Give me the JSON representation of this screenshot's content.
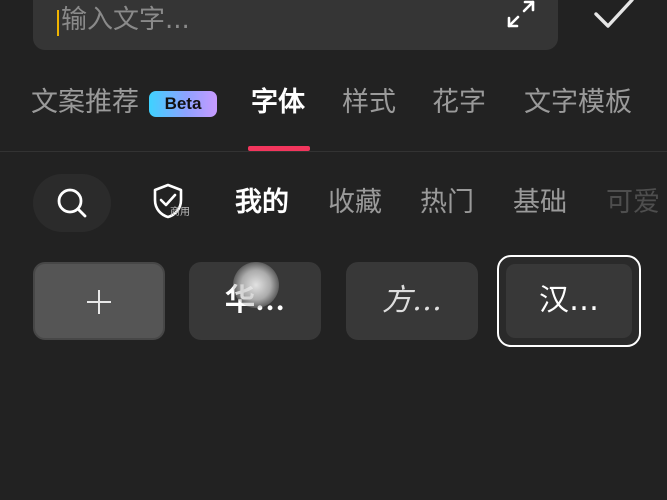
{
  "input": {
    "placeholder": "输入文字..."
  },
  "icons": {
    "expand": "expand-icon",
    "confirm": "check-icon",
    "search": "search-icon",
    "commercial": "shield-check-icon",
    "add": "plus-icon"
  },
  "main_tabs": [
    {
      "label": "文案推荐",
      "badge": "Beta",
      "active": false
    },
    {
      "label": "字体",
      "active": true
    },
    {
      "label": "样式",
      "active": false
    },
    {
      "label": "花字",
      "active": false
    },
    {
      "label": "文字模板",
      "active": false
    }
  ],
  "sub_tabs": {
    "commercial_label": "商用",
    "items": [
      {
        "label": "我的",
        "active": true
      },
      {
        "label": "收藏",
        "active": false
      },
      {
        "label": "热门",
        "active": false
      },
      {
        "label": "基础",
        "active": false
      },
      {
        "label": "可爱",
        "active": false
      }
    ]
  },
  "font_cards": [
    {
      "label": "华…",
      "selected": false
    },
    {
      "label": "方…",
      "selected": false
    },
    {
      "label": "汉…",
      "selected": true
    }
  ],
  "colors": {
    "background": "#222222",
    "accent_underline": "#f2365d",
    "caret": "#f0b400"
  }
}
